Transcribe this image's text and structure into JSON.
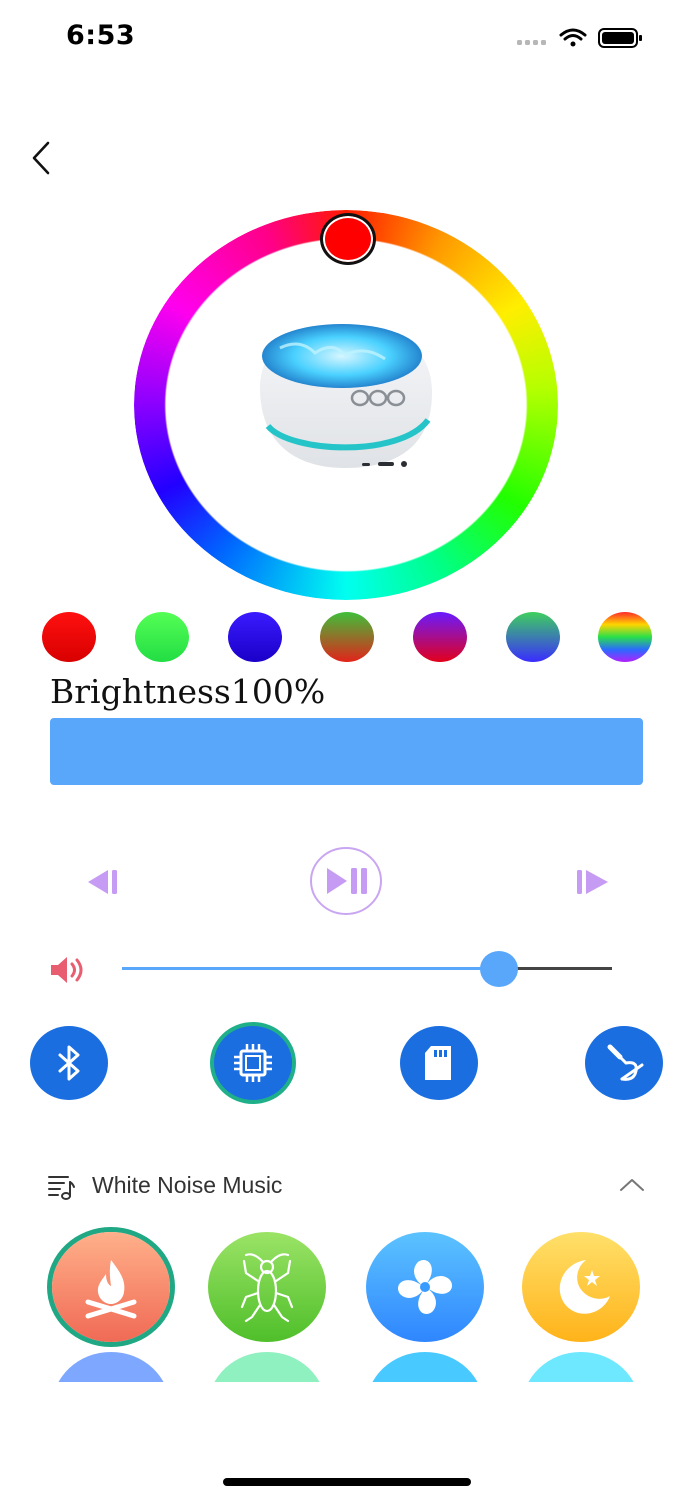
{
  "status_bar": {
    "time": "6:53"
  },
  "color_presets": [
    {
      "name": "red",
      "colors": [
        "#ff1010",
        "#d80000"
      ]
    },
    {
      "name": "green",
      "colors": [
        "#55ff55",
        "#22dd44"
      ]
    },
    {
      "name": "blue",
      "colors": [
        "#3a1bff",
        "#1a00c8"
      ]
    },
    {
      "name": "green-red",
      "colors": [
        "#3fbf3a",
        "#e2231a"
      ]
    },
    {
      "name": "purple-red",
      "colors": [
        "#6a1bff",
        "#e3001b"
      ]
    },
    {
      "name": "green-blue",
      "colors": [
        "#3ecf5e",
        "#3a2cff"
      ]
    },
    {
      "name": "rainbow",
      "colors": [
        "#ff2a2a",
        "#ffd400",
        "#29e04a",
        "#2a6bff",
        "#b021ff"
      ]
    }
  ],
  "brightness": {
    "label": "Brightness100%",
    "value": 100
  },
  "volume": {
    "level": 0.77
  },
  "mode_buttons": [
    {
      "name": "bluetooth",
      "active": false
    },
    {
      "name": "chip",
      "active": true
    },
    {
      "name": "sd-card",
      "active": false
    },
    {
      "name": "aux",
      "active": false
    }
  ],
  "white_noise": {
    "title": "White Noise Music",
    "items": [
      {
        "name": "fire",
        "colors": [
          "#ffb08a",
          "#f06a55"
        ],
        "active": true
      },
      {
        "name": "cricket",
        "colors": [
          "#9be366",
          "#4fbf2a"
        ],
        "active": false
      },
      {
        "name": "fan",
        "colors": [
          "#5cc3ff",
          "#2f86ff"
        ],
        "active": false
      },
      {
        "name": "moon",
        "colors": [
          "#ffe06a",
          "#ffb31a"
        ],
        "active": false
      }
    ],
    "partial_colors": [
      "#7ea8ff",
      "#8ff0c0",
      "#48c9ff",
      "#6de8ff"
    ]
  }
}
